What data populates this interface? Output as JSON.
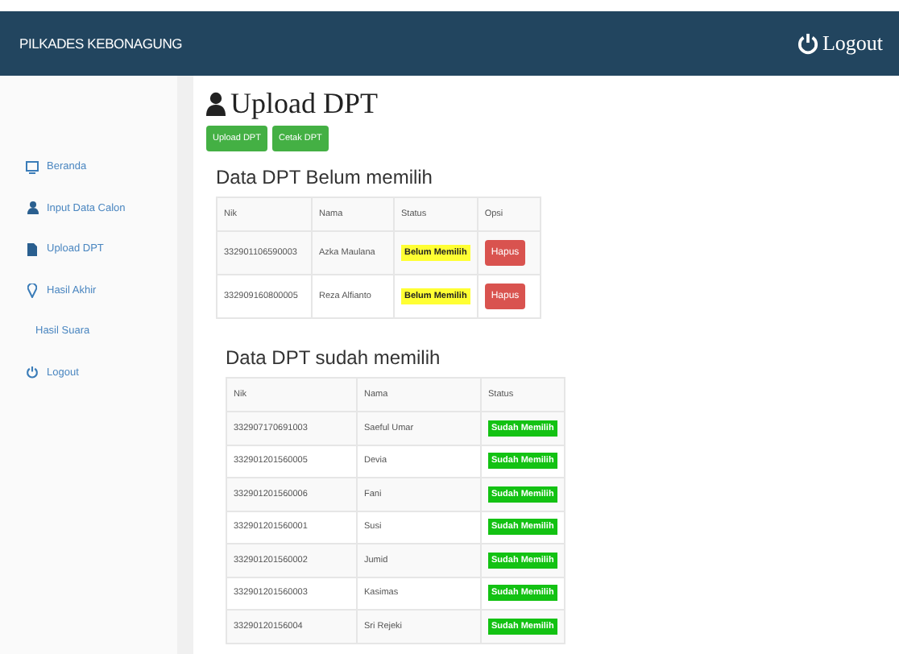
{
  "header": {
    "brand": "PILKADES KEBONAGUNG",
    "logout": "Logout"
  },
  "sidebar": {
    "items": [
      {
        "label": "Beranda"
      },
      {
        "label": "Input Data Calon"
      },
      {
        "label": "Upload DPT"
      },
      {
        "label": "Hasil Akhir"
      },
      {
        "label": "Hasil Suara"
      },
      {
        "label": "Logout"
      }
    ]
  },
  "page": {
    "title": "Upload DPT",
    "buttons": [
      "Upload DPT",
      "Cetak DPT"
    ]
  },
  "tables": [
    {
      "title": "Data DPT Belum memilih",
      "columns": [
        "Nik",
        "Nama",
        "Status",
        "Opsi"
      ],
      "rows": [
        {
          "nik": "332901106590003",
          "nama": "Azka Maulana",
          "status": {
            "text": "Belum Memilih",
            "kind": "pending"
          },
          "action": "Hapus"
        },
        {
          "nik": "332909160800005",
          "nama": "Reza Alfianto",
          "status": {
            "text": "Belum Memilih",
            "kind": "pending"
          },
          "action": "Hapus"
        }
      ]
    },
    {
      "title": "Data DPT sudah memilih",
      "columns": [
        "Nik",
        "Nama",
        "Status"
      ],
      "rows": [
        {
          "nik": "332907170691003",
          "nama": "Saeful Umar",
          "status": {
            "text": "Sudah Memilih",
            "kind": "done"
          }
        },
        {
          "nik": "332901201560005",
          "nama": "Devia",
          "status": {
            "text": "Sudah Memilih",
            "kind": "done"
          }
        },
        {
          "nik": "332901201560006",
          "nama": "Fani",
          "status": {
            "text": "Sudah Memilih",
            "kind": "done"
          }
        },
        {
          "nik": "332901201560001",
          "nama": "Susi",
          "status": {
            "text": "Sudah Memilih",
            "kind": "done"
          }
        },
        {
          "nik": "332901201560002",
          "nama": "Jumid",
          "status": {
            "text": "Sudah Memilih",
            "kind": "done"
          }
        },
        {
          "nik": "332901201560003",
          "nama": "Kasimas",
          "status": {
            "text": "Sudah Memilih",
            "kind": "done"
          }
        },
        {
          "nik": "33290120156004",
          "nama": "Sri Rejeki",
          "status": {
            "text": "Sudah Memilih",
            "kind": "done"
          }
        }
      ]
    }
  ]
}
